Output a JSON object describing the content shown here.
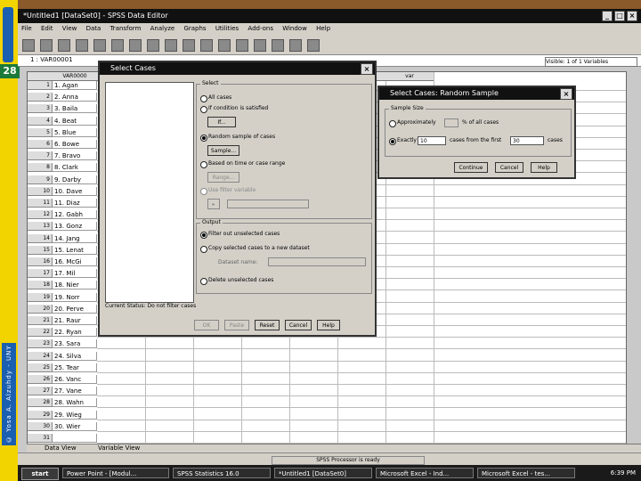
{
  "slide": {
    "number": "28",
    "credit": "© Yosa A. Alzuhdy - UNY"
  },
  "window": {
    "title": "*Untitled1 [DataSet0] - SPSS Data Editor",
    "menu": [
      "File",
      "Edit",
      "View",
      "Data",
      "Transform",
      "Analyze",
      "Graphs",
      "Utilities",
      "Add-ons",
      "Window",
      "Help"
    ],
    "toolbar_icons": [
      "open-icon",
      "save-icon",
      "print-icon",
      "dialog-recall-icon",
      "undo-icon",
      "redo-icon",
      "goto-case-icon",
      "variables-icon",
      "find-icon",
      "insert-cases-icon",
      "insert-variable-icon",
      "split-file-icon",
      "weight-cases-icon",
      "select-cases-icon",
      "value-labels-icon",
      "use-sets-icon",
      "show-all-icon"
    ],
    "cell_ref": "1 : VAR00001",
    "visible_count": "Visible: 1 of 1 Variables"
  },
  "grid": {
    "first_col_header": "VAR0000",
    "var_headers": [
      "var",
      "var",
      "var",
      "var",
      "var",
      "var",
      "var"
    ],
    "rows": [
      {
        "n": "1",
        "v": "1. Agan"
      },
      {
        "n": "2",
        "v": "2. Anna"
      },
      {
        "n": "3",
        "v": "3. Baila"
      },
      {
        "n": "4",
        "v": "4. Beat"
      },
      {
        "n": "5",
        "v": "5. Blue"
      },
      {
        "n": "6",
        "v": "6. Bowe"
      },
      {
        "n": "7",
        "v": "7. Bravo"
      },
      {
        "n": "8",
        "v": "8. Clark"
      },
      {
        "n": "9",
        "v": "9. Darby"
      },
      {
        "n": "10",
        "v": "10. Dave"
      },
      {
        "n": "11",
        "v": "11. Diaz"
      },
      {
        "n": "12",
        "v": "12. Gabh"
      },
      {
        "n": "13",
        "v": "13. Gonz"
      },
      {
        "n": "14",
        "v": "14. Jang"
      },
      {
        "n": "15",
        "v": "15. Lenat"
      },
      {
        "n": "16",
        "v": "16. McGi"
      },
      {
        "n": "17",
        "v": "17. Mil"
      },
      {
        "n": "18",
        "v": "18. Nier"
      },
      {
        "n": "19",
        "v": "19. Norr"
      },
      {
        "n": "20",
        "v": "20. Perve"
      },
      {
        "n": "21",
        "v": "21. Raur"
      },
      {
        "n": "22",
        "v": "22. Ryan"
      },
      {
        "n": "23",
        "v": "23. Sara"
      },
      {
        "n": "24",
        "v": "24. Silva"
      },
      {
        "n": "25",
        "v": "25. Tear"
      },
      {
        "n": "26",
        "v": "26. Vanc"
      },
      {
        "n": "27",
        "v": "27. Vane"
      },
      {
        "n": "28",
        "v": "28. Wahn"
      },
      {
        "n": "29",
        "v": "29. Wieg"
      },
      {
        "n": "30",
        "v": "30. Wier"
      },
      {
        "n": "31",
        "v": ""
      }
    ]
  },
  "tabs": {
    "data_view": "Data View",
    "variable_view": "Variable View"
  },
  "status": "SPSS Processor is ready",
  "select_cases": {
    "title": "Select Cases",
    "select_label": "Select",
    "opt_all": "All cases",
    "opt_if": "If condition is satisfied",
    "if_button": "If...",
    "opt_random": "Random sample of cases",
    "sample_button": "Sample...",
    "opt_range": "Based on time or case range",
    "range_button": "Range...",
    "opt_filter": "Use filter variable",
    "output_label": "Output",
    "out_filter": "Filter out unselected cases",
    "out_copy": "Copy selected cases to a new dataset",
    "dataset_name_label": "Dataset name:",
    "out_delete": "Delete unselected cases",
    "status": "Current Status: Do not filter cases",
    "btn_ok": "OK",
    "btn_paste": "Paste",
    "btn_reset": "Reset",
    "btn_cancel": "Cancel",
    "btn_help": "Help"
  },
  "random_sample": {
    "title": "Select Cases: Random Sample",
    "group_label": "Sample Size",
    "approx_label": "Approximately",
    "approx_suffix": "% of all cases",
    "exactly_label": "Exactly",
    "exactly_value": "10",
    "from_first_label": "cases from the first",
    "first_value": "30",
    "cases_label": "cases",
    "btn_continue": "Continue",
    "btn_cancel": "Cancel",
    "btn_help": "Help"
  },
  "taskbar": {
    "start": "start",
    "items": [
      "Power Point - [Modul...",
      "SPSS Statistics 16.0",
      "*Untitled1 [DataSet0]",
      "Microsoft Excel - Ind...",
      "Microsoft Excel - tes..."
    ],
    "clock": "6:39 PM"
  },
  "colors": {
    "slide_accent": "#f2d400",
    "slide_blue": "#1b5fb0",
    "slide_number_bg": "#1b7a3a"
  }
}
